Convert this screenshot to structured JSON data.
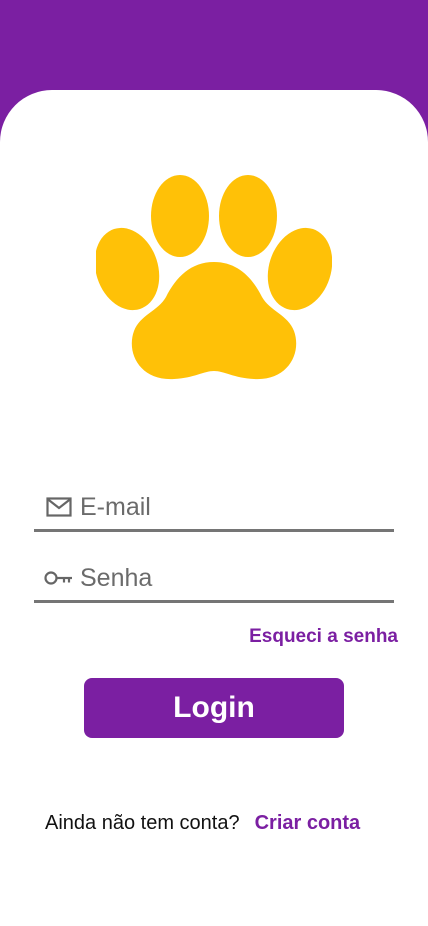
{
  "colors": {
    "primary": "#7b1fa2",
    "paw": "#FFC107",
    "background": "#ffffff"
  },
  "logo": {
    "icon": "paw-icon"
  },
  "email_field": {
    "icon": "mail-icon",
    "placeholder": "E-mail",
    "value": ""
  },
  "password_field": {
    "icon": "key-icon",
    "placeholder": "Senha",
    "value": ""
  },
  "forgot_password": {
    "label": "Esqueci a senha"
  },
  "login_button": {
    "label": "Login"
  },
  "signup": {
    "question": "Ainda não tem conta?",
    "link_label": "Criar conta"
  }
}
